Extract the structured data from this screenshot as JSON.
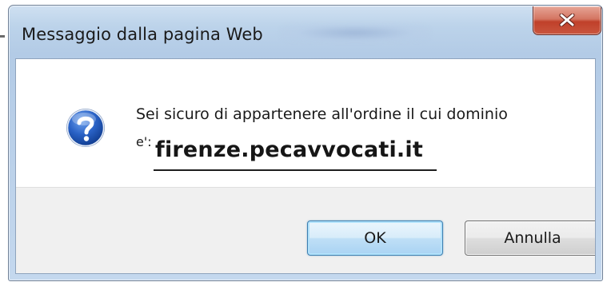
{
  "dialog": {
    "title": "Messaggio dalla pagina Web",
    "close_icon": "close-icon",
    "message_icon": "question-icon",
    "message_line1": "Sei sicuro di appartenere all'ordine il cui dominio",
    "message_prefix": "e':",
    "domain": "firenze.pecavvocati.it",
    "buttons": {
      "ok_label": "OK",
      "cancel_label": "Annulla"
    }
  },
  "colors": {
    "title_bar": "#bcd3ea",
    "close_button": "#c0402a",
    "ok_button_border": "#3c7fb1",
    "icon_blue": "#1f56b8",
    "footer": "#f0f0f0"
  }
}
